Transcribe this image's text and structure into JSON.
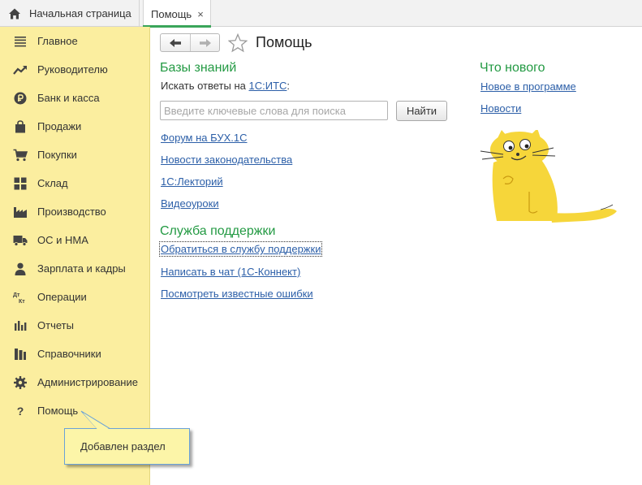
{
  "tabs": [
    {
      "label": "Начальная страница",
      "icon": "home-icon"
    },
    {
      "label": "Помощь",
      "close_glyph": "×"
    }
  ],
  "sidebar": {
    "items": [
      {
        "label": "Главное",
        "icon": "menu-lines-icon"
      },
      {
        "label": "Руководителю",
        "icon": "trend-chart-icon"
      },
      {
        "label": "Банк и касса",
        "icon": "ruble-coin-icon"
      },
      {
        "label": "Продажи",
        "icon": "shopping-bag-icon"
      },
      {
        "label": "Покупки",
        "icon": "shopping-cart-icon"
      },
      {
        "label": "Склад",
        "icon": "warehouse-grid-icon"
      },
      {
        "label": "Производство",
        "icon": "factory-icon"
      },
      {
        "label": "ОС и НМА",
        "icon": "truck-icon"
      },
      {
        "label": "Зарплата и кадры",
        "icon": "person-icon"
      },
      {
        "label": "Операции",
        "icon": "debit-credit-icon",
        "icon_text_top": "Дт",
        "icon_text_bottom": "Кт"
      },
      {
        "label": "Отчеты",
        "icon": "bar-chart-icon"
      },
      {
        "label": "Справочники",
        "icon": "books-icon"
      },
      {
        "label": "Администрирование",
        "icon": "gear-icon"
      },
      {
        "label": "Помощь",
        "icon": "question-icon",
        "icon_text": "?"
      }
    ]
  },
  "callout": {
    "text": "Добавлен раздел"
  },
  "page": {
    "title": "Помощь"
  },
  "knowledge": {
    "title": "Базы знаний",
    "search_prefix": "Искать ответы на ",
    "search_link": "1С:ИТС",
    "search_suffix": ":",
    "search_placeholder": "Введите ключевые слова для поиска",
    "search_value": "",
    "find_button": "Найти",
    "links": [
      "Форум на БУХ.1С",
      "Новости законодательства",
      "1С:Лекторий",
      "Видеоуроки"
    ]
  },
  "support": {
    "title": "Служба поддержки",
    "links": [
      "Обратиться в службу поддержки",
      "Написать в чат (1С-Коннект)",
      "Посмотреть известные ошибки"
    ]
  },
  "whats_new": {
    "title": "Что нового",
    "links": [
      "Новое в программе",
      "Новости"
    ]
  },
  "colors": {
    "sidebar_bg": "#fbee9f",
    "section_title": "#239a43",
    "link": "#2c5fa8",
    "callout_bg": "#fcf5a8",
    "callout_border": "#6aa2d8",
    "tab_accent": "#3aa55a"
  }
}
